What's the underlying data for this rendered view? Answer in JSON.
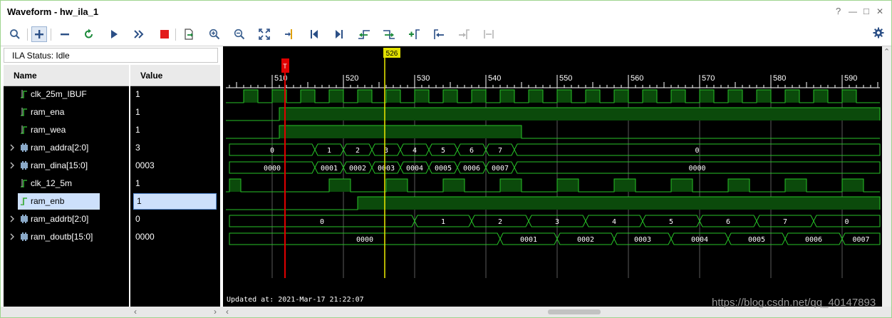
{
  "window": {
    "title": "Waveform - hw_ila_1",
    "help": "?",
    "minimize": "—",
    "maximize": "□",
    "close": "✕"
  },
  "toolbar": {
    "buttons": [
      {
        "name": "search",
        "icon": "magnifier-icon"
      },
      {
        "name": "add",
        "icon": "plus-icon",
        "pressed": true
      },
      {
        "name": "remove",
        "icon": "minus-icon"
      },
      {
        "name": "run-trigger-immediate",
        "icon": "refresh-icon"
      },
      {
        "name": "run-trigger",
        "icon": "play-icon"
      },
      {
        "name": "auto-retrigger",
        "icon": "fast-forward-icon"
      },
      {
        "name": "stop",
        "icon": "stop-icon"
      },
      {
        "name": "export",
        "icon": "export-icon"
      },
      {
        "name": "zoom-in",
        "icon": "zoom-in-icon"
      },
      {
        "name": "zoom-out",
        "icon": "zoom-out-icon"
      },
      {
        "name": "zoom-fit",
        "icon": "zoom-fit-icon"
      },
      {
        "name": "go-to-cursor",
        "icon": "cursor-icon"
      },
      {
        "name": "go-to-start",
        "icon": "go-start-icon"
      },
      {
        "name": "go-to-end",
        "icon": "go-end-icon"
      },
      {
        "name": "previous-transition",
        "icon": "prev-transition-icon"
      },
      {
        "name": "next-transition",
        "icon": "next-transition-icon"
      },
      {
        "name": "add-marker",
        "icon": "add-marker-icon"
      },
      {
        "name": "previous-marker",
        "icon": "prev-marker-icon"
      },
      {
        "name": "next-marker",
        "icon": "next-marker-icon"
      },
      {
        "name": "swap-cursors",
        "icon": "swap-cursors-icon"
      }
    ],
    "settings_icon": "gear-icon"
  },
  "ila_status": "ILA Status: Idle",
  "columns": {
    "name": "Name",
    "value": "Value"
  },
  "signals": [
    {
      "name": "clk_25m_IBUF",
      "value": "1",
      "type": "bit",
      "expandable": false,
      "selected": false
    },
    {
      "name": "ram_ena",
      "value": "1",
      "type": "bit",
      "expandable": false,
      "selected": false
    },
    {
      "name": "ram_wea",
      "value": "1",
      "type": "bit",
      "expandable": false,
      "selected": false
    },
    {
      "name": "ram_addra[2:0]",
      "value": "3",
      "type": "bus",
      "expandable": true,
      "selected": false
    },
    {
      "name": "ram_dina[15:0]",
      "value": "0003",
      "type": "bus",
      "expandable": true,
      "selected": false
    },
    {
      "name": "clk_12_5m",
      "value": "1",
      "type": "bit",
      "expandable": false,
      "selected": false
    },
    {
      "name": "ram_enb",
      "value": "1",
      "type": "bit",
      "expandable": false,
      "selected": true
    },
    {
      "name": "ram_addrb[2:0]",
      "value": "0",
      "type": "bus",
      "expandable": true,
      "selected": false
    },
    {
      "name": "ram_doutb[15:0]",
      "value": "0000",
      "type": "bus",
      "expandable": true,
      "selected": false
    }
  ],
  "timeline": {
    "ticks": [
      "510",
      "520",
      "530",
      "540",
      "550",
      "560",
      "570",
      "580",
      "590"
    ],
    "cursor": "526",
    "trigger_marker": "T"
  },
  "waveforms": {
    "clk_25m_IBUF": {
      "transitions": [
        506,
        508,
        510,
        512,
        514,
        516,
        518,
        520,
        522,
        524,
        526,
        528,
        530,
        532,
        534,
        536,
        538,
        540,
        542,
        544,
        546,
        548,
        550,
        552,
        554,
        556,
        558,
        560,
        562,
        564,
        566,
        568,
        570,
        572,
        574,
        576,
        578,
        580,
        582,
        584,
        586,
        588,
        590,
        592,
        594
      ]
    },
    "ram_ena": {
      "high_from": 511
    },
    "ram_wea": {
      "high_from": 511,
      "high_to": 545
    },
    "clk_12_5m": {
      "highs": [
        [
          504,
          505.6
        ],
        [
          518,
          521
        ],
        [
          526,
          529
        ],
        [
          534,
          537
        ],
        [
          542,
          545
        ],
        [
          550,
          553
        ],
        [
          558,
          561
        ],
        [
          566,
          569
        ],
        [
          574,
          577
        ],
        [
          582,
          585
        ],
        [
          590,
          593
        ]
      ]
    },
    "ram_enb": {
      "high_from": 522
    },
    "ram_addra[2:0]": {
      "segments": [
        {
          "label": "0",
          "from": 504,
          "to": 516
        },
        {
          "label": "1",
          "from": 516,
          "to": 520
        },
        {
          "label": "2",
          "from": 520,
          "to": 524
        },
        {
          "label": "3",
          "from": 524,
          "to": 528
        },
        {
          "label": "4",
          "from": 528,
          "to": 532
        },
        {
          "label": "5",
          "from": 532,
          "to": 536
        },
        {
          "label": "6",
          "from": 536,
          "to": 540
        },
        {
          "label": "7",
          "from": 540,
          "to": 544
        },
        {
          "label": "0",
          "from": 544,
          "to": 596
        }
      ]
    },
    "ram_dina[15:0]": {
      "segments": [
        {
          "label": "0000",
          "from": 504,
          "to": 516
        },
        {
          "label": "0001",
          "from": 516,
          "to": 520
        },
        {
          "label": "0002",
          "from": 520,
          "to": 524
        },
        {
          "label": "0003",
          "from": 524,
          "to": 528
        },
        {
          "label": "0004",
          "from": 528,
          "to": 532
        },
        {
          "label": "0005",
          "from": 532,
          "to": 536
        },
        {
          "label": "0006",
          "from": 536,
          "to": 540
        },
        {
          "label": "0007",
          "from": 540,
          "to": 544
        },
        {
          "label": "0000",
          "from": 544,
          "to": 596
        }
      ]
    },
    "ram_addrb[2:0]": {
      "segments": [
        {
          "label": "0",
          "from": 504,
          "to": 530
        },
        {
          "label": "1",
          "from": 530,
          "to": 538
        },
        {
          "label": "2",
          "from": 538,
          "to": 546
        },
        {
          "label": "3",
          "from": 546,
          "to": 554
        },
        {
          "label": "4",
          "from": 554,
          "to": 562
        },
        {
          "label": "5",
          "from": 562,
          "to": 570
        },
        {
          "label": "6",
          "from": 570,
          "to": 578
        },
        {
          "label": "7",
          "from": 578,
          "to": 586
        },
        {
          "label": "0",
          "from": 586,
          "to": 596
        }
      ]
    },
    "ram_doutb[15:0]": {
      "segments": [
        {
          "label": "0000",
          "from": 504,
          "to": 542
        },
        {
          "label": "0001",
          "from": 542,
          "to": 550
        },
        {
          "label": "0002",
          "from": 550,
          "to": 558
        },
        {
          "label": "0003",
          "from": 558,
          "to": 566
        },
        {
          "label": "0004",
          "from": 566,
          "to": 574
        },
        {
          "label": "0005",
          "from": 574,
          "to": 582
        },
        {
          "label": "0006",
          "from": 582,
          "to": 590
        },
        {
          "label": "0007",
          "from": 590,
          "to": 596
        }
      ]
    }
  },
  "updated_at": "Updated at: 2021-Mar-17 21:22:07",
  "watermark": "https://blog.csdn.net/qq_40147893",
  "colors": {
    "wave": "#27c227",
    "fill": "#0b4a0b",
    "grid": "#5a5a5a",
    "cursor": "#e0e000",
    "trigger": "#e00000",
    "selection": "#cde0fb",
    "text": "#ffffff"
  }
}
